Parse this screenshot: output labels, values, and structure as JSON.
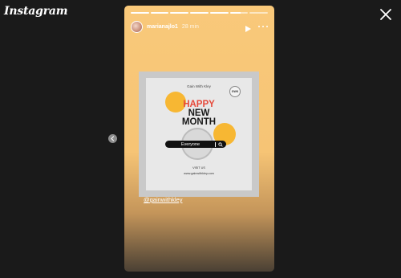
{
  "app": {
    "logo_text": "Instagram"
  },
  "story": {
    "progress_segments": 7,
    "segments_done": 5,
    "active_fraction": 0.6,
    "username": "marianajlo1",
    "time_ago": "28 min",
    "post": {
      "brand": "Gain With Kley",
      "badge": "GWK",
      "headline": [
        "HAPPY",
        "NEW",
        "MONTH"
      ],
      "search_text": "Everyone",
      "visit_label": "VISIT US",
      "website": "www.gainwithkley.com"
    },
    "mention": "@gainwithkley"
  },
  "colors": {
    "background": "#1a1a1a",
    "story_gradient_top": "#f9c97a",
    "accent_yellow": "#f7b733",
    "headline_red": "#e64a3b"
  },
  "icons": {
    "close": "close-icon",
    "play": "play-icon",
    "more": "more-icon",
    "prev": "chevron-left-icon",
    "search": "search-icon"
  }
}
